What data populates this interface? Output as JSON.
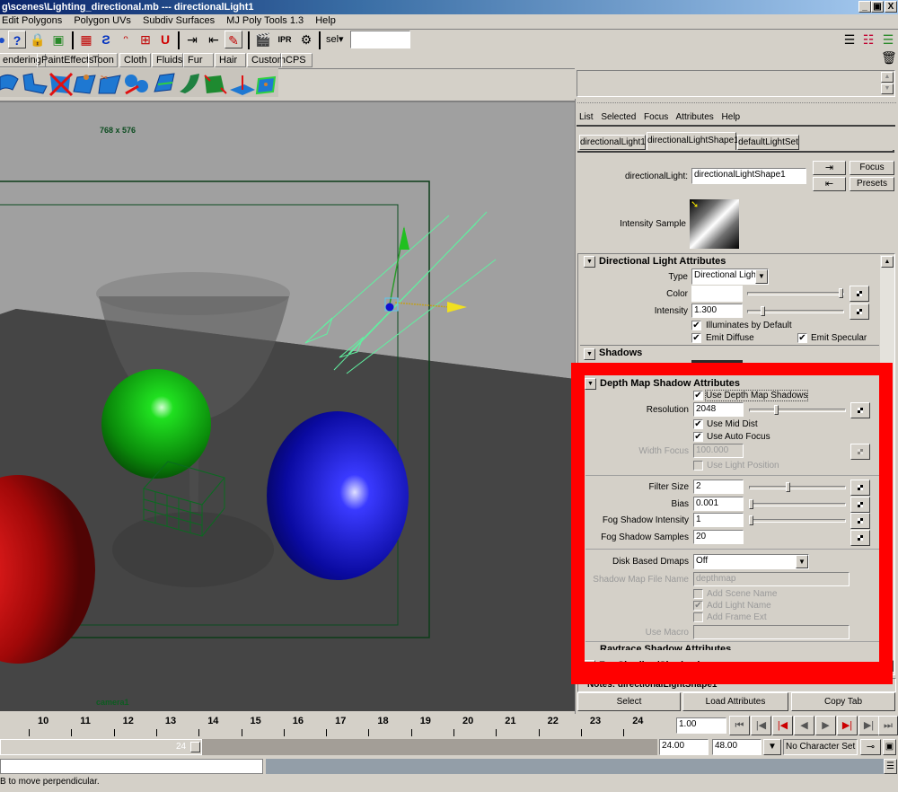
{
  "window": {
    "title": "g\\scenes\\Lighting_directional.mb  ---  directionalLight1",
    "controls": [
      "_",
      "▣",
      "X"
    ]
  },
  "menubar": [
    "Edit Polygons",
    "Polygon UVs",
    "Subdiv Surfaces",
    "MJ Poly Tools 1.3",
    "Help"
  ],
  "status_line": {
    "sel_label": "sel▾",
    "sel_input": ""
  },
  "shelf_tabs": [
    "endering",
    "PaintEffects",
    "Toon",
    "Cloth",
    "Fluids",
    "Fur",
    "Hair",
    "Custom",
    "CPS"
  ],
  "shelf_icons": [
    "nurbs-revolve-icon",
    "nurbs-loft-icon",
    "delete-surface-icon",
    "extrude-surface-icon",
    "trim-surface-icon",
    "detach-surface-icon",
    "insert-isoparm-icon",
    "bend-surface-icon",
    "rebuild-surface-icon",
    "sculpt-surface-icon",
    "fillet-surface-icon"
  ],
  "viewport": {
    "resolution_label": "768 x 576",
    "camera_label": "camera1"
  },
  "attribute_editor": {
    "menu": [
      "List",
      "Selected",
      "Focus",
      "Attributes",
      "Help"
    ],
    "tabs": [
      {
        "label": "directionalLight1",
        "active": false
      },
      {
        "label": "directionalLightShape1",
        "active": true
      },
      {
        "label": "defaultLightSet",
        "active": false
      }
    ],
    "node_type_label": "directionalLight:",
    "node_name": "directionalLightShape1",
    "focus_button": "Focus",
    "presets_button": "Presets",
    "intensity_sample_label": "Intensity Sample",
    "sections": {
      "directional": {
        "title": "Directional Light Attributes",
        "type_label": "Type",
        "type_value": "Directional Light",
        "color_label": "Color",
        "color_value": "#ffffff",
        "color_slider": 1.0,
        "intensity_label": "Intensity",
        "intensity_value": "1.300",
        "intensity_slider": 0.15,
        "illuminates_label": "Illuminates by Default",
        "illuminates": true,
        "emit_diffuse_label": "Emit Diffuse",
        "emit_diffuse": true,
        "emit_specular_label": "Emit Specular",
        "emit_specular": true
      },
      "shadows": {
        "title": "Shadows",
        "shadow_color": "#2a2a2a"
      },
      "depth_map": {
        "title": "Depth Map Shadow Attributes",
        "use_depth_map_label": "Use Depth Map Shadows",
        "use_depth_map": true,
        "resolution_label": "Resolution",
        "resolution_value": "2048",
        "resolution_slider": 0.27,
        "use_mid_dist_label": "Use Mid Dist",
        "use_mid_dist": true,
        "use_auto_focus_label": "Use Auto Focus",
        "use_auto_focus": true,
        "width_focus_label": "Width Focus",
        "width_focus_value": "100.000",
        "use_light_position_label": "Use Light Position",
        "use_light_position": false,
        "filter_size_label": "Filter Size",
        "filter_size_value": "2",
        "filter_size_slider": 0.4,
        "bias_label": "Bias",
        "bias_value": "0.001",
        "bias_slider": 0.0,
        "fog_intensity_label": "Fog Shadow Intensity",
        "fog_intensity_value": "1",
        "fog_intensity_slider": 0.0,
        "fog_samples_label": "Fog Shadow Samples",
        "fog_samples_value": "20",
        "disk_dmaps_label": "Disk Based Dmaps",
        "disk_dmaps_value": "Off",
        "shadow_map_file_label": "Shadow Map File Name",
        "shadow_map_file_value": "depthmap",
        "add_scene_name_label": "Add Scene Name",
        "add_scene_name": false,
        "add_light_name_label": "Add Light Name",
        "add_light_name": true,
        "add_frame_ext_label": "Add Frame Ext",
        "add_frame_ext": false,
        "use_macro_label": "Use Macro",
        "use_macro_value": ""
      },
      "raytrace": {
        "title": "Raytrace Shadow Attributes"
      },
      "fur": {
        "title": "Fur Shading/Shadowing"
      }
    },
    "notes_label": "Notes: directionalLightShape1",
    "bottom_buttons": [
      "Select",
      "Load Attributes",
      "Copy Tab"
    ]
  },
  "timeline": {
    "ticks": [
      "10",
      "11",
      "12",
      "13",
      "14",
      "15",
      "16",
      "17",
      "18",
      "19",
      "20",
      "21",
      "22",
      "23",
      "24"
    ],
    "current_frame": "1.00",
    "range_end_marker": "24",
    "range_start": "24.00",
    "range_end": "48.00",
    "character_set": "No Character Set"
  },
  "help_line": "B to move perpendicular.",
  "highlight_color": "#ff0000"
}
